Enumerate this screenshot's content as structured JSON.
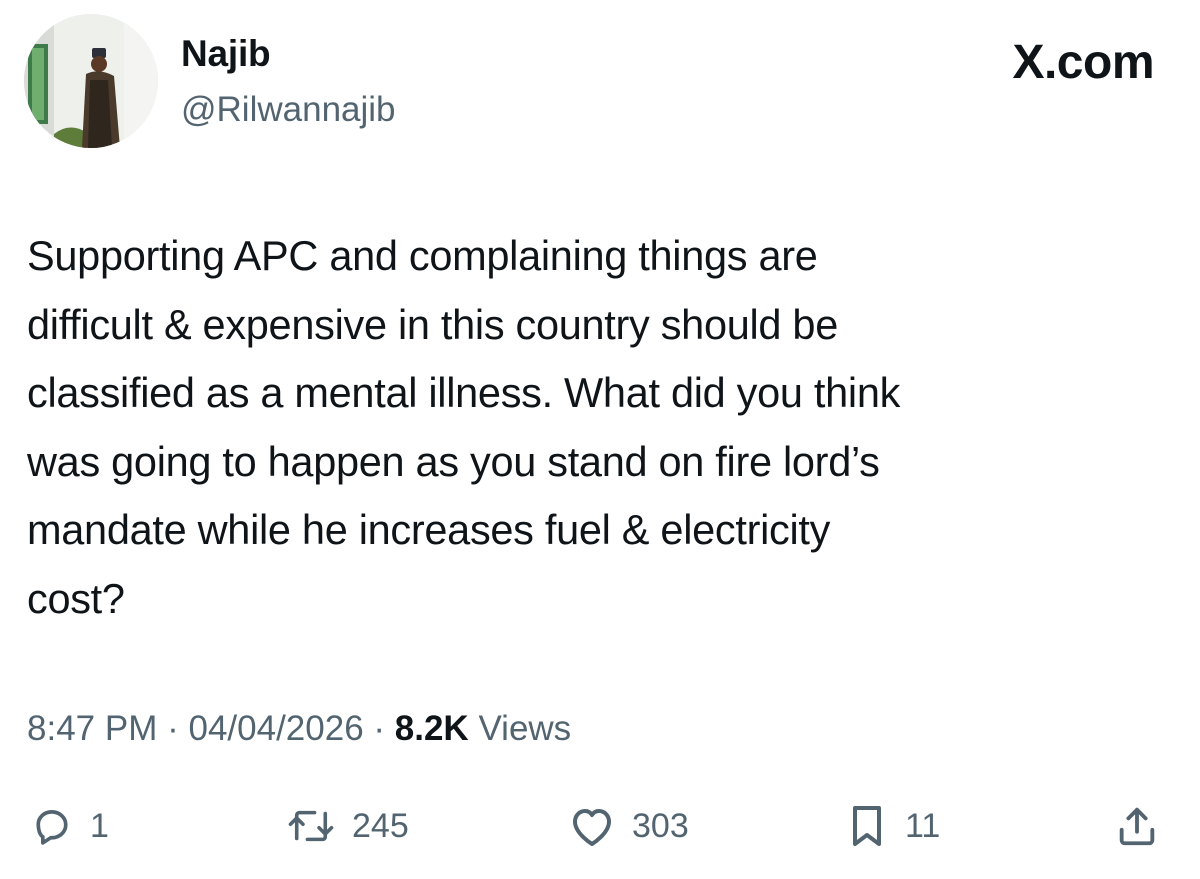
{
  "author": {
    "display_name": "Najib",
    "handle": "@Rilwannajib"
  },
  "brand": {
    "label": "X.com"
  },
  "tweet": {
    "text": "Supporting APC and complaining things are\ndifficult & expensive in this country should be\nclassified as a mental illness. What did you think\nwas going to happen as you stand on fire lord’s\nmandate while  he increases fuel & electricity\ncost?"
  },
  "meta": {
    "time": "8:47 PM",
    "date": "04/04/2026",
    "separator": "·",
    "views_count": "8.2K",
    "views_label": "Views"
  },
  "actions": {
    "reply": {
      "icon": "reply-icon",
      "count": "1"
    },
    "retweet": {
      "icon": "retweet-icon",
      "count": "245"
    },
    "like": {
      "icon": "heart-icon",
      "count": "303"
    },
    "bookmark": {
      "icon": "bookmark-icon",
      "count": "11"
    },
    "share": {
      "icon": "share-icon"
    }
  },
  "colors": {
    "text": "#0f1419",
    "secondary": "#536471",
    "background": "#ffffff"
  }
}
